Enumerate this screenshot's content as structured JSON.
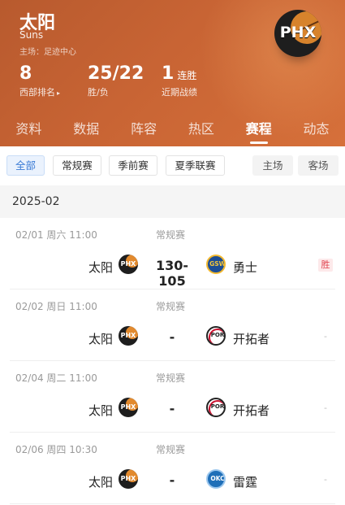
{
  "team": {
    "name": "太阳",
    "name_en": "Suns",
    "home_court": "主场：足迹中心",
    "logo_text": "PHX"
  },
  "stats": {
    "rank": {
      "value": "8",
      "label": "西部排名",
      "arrow": "▸"
    },
    "record": {
      "value": "25/22",
      "label": "胜/负"
    },
    "streak": {
      "value": "1",
      "suffix": "连胜",
      "label": "近期战绩"
    }
  },
  "tabs": [
    "资料",
    "数据",
    "阵容",
    "热区",
    "赛程",
    "动态"
  ],
  "active_tab": "赛程",
  "filters": {
    "types": [
      "全部",
      "常规赛",
      "季前赛",
      "夏季联赛"
    ],
    "active": "全部",
    "venues": [
      "主场",
      "客场"
    ]
  },
  "month": "2025-02",
  "games": [
    {
      "date": "02/01",
      "weekday": "周六",
      "time": "11:00",
      "type": "常规赛",
      "home": "太阳",
      "home_logo": "PHX",
      "score": "130-105",
      "away": "勇士",
      "away_logo": "GSW",
      "result": "胜"
    },
    {
      "date": "02/02",
      "weekday": "周日",
      "time": "11:00",
      "type": "常规赛",
      "home": "太阳",
      "home_logo": "PHX",
      "score": "-",
      "away": "开拓者",
      "away_logo": "POR",
      "result": "-"
    },
    {
      "date": "02/04",
      "weekday": "周二",
      "time": "11:00",
      "type": "常规赛",
      "home": "太阳",
      "home_logo": "PHX",
      "score": "-",
      "away": "开拓者",
      "away_logo": "POR",
      "result": "-"
    },
    {
      "date": "02/06",
      "weekday": "周四",
      "time": "10:30",
      "type": "常规赛",
      "home": "太阳",
      "home_logo": "PHX",
      "score": "-",
      "away": "雷霆",
      "away_logo": "OKC",
      "result": "-"
    }
  ],
  "colors": {
    "header": "#c86434",
    "active_filter": "#3a7bd5",
    "win": "#e0434e"
  }
}
